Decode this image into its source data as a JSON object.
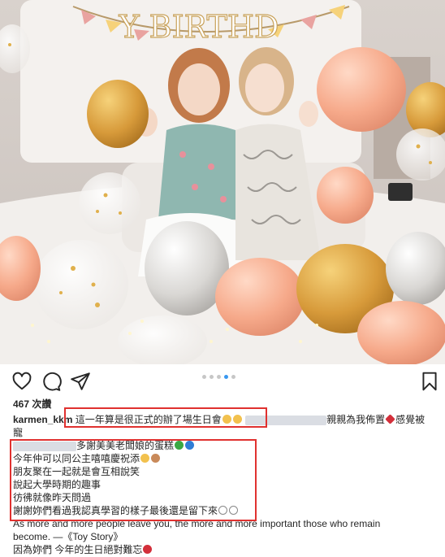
{
  "post": {
    "likes": "467 次讚",
    "username": "karmen_kkm",
    "caption_line1_a": "這一年算是很正式的辦了場生日會",
    "caption_line1_b": "親親為我佈置",
    "caption_line1_c": "感覺被",
    "caption_line2": "寵",
    "caption_line3": "多謝美美老闆娘的蛋糕",
    "caption_line4": "今年仲可以同公主嘻嘻慶祝添",
    "caption_line5": "朋友聚在一起就是會互相說笑",
    "caption_line6": "說起大學時期的趣事",
    "caption_line7": "彷彿就像昨天問過",
    "caption_line8": "謝謝妳們看過我認真學習的樣子最後還是留下來",
    "caption_line9": "As more and more people leave you, the more and more important those who remain",
    "caption_line10": "become. —《Toy Story》",
    "caption_line11": "因為妳們 今年的生日絕對難忘"
  },
  "photo": {
    "banner_text": "Y BIRTHD"
  },
  "carousel": {
    "total": 5,
    "active_index": 3
  },
  "icons": {
    "like": "heart-outline-icon",
    "comment": "comment-bubble-icon",
    "share": "paper-plane-icon",
    "save": "bookmark-icon"
  },
  "colors": {
    "highlight_box": "#e0312f",
    "active_dot": "#3897f0"
  }
}
